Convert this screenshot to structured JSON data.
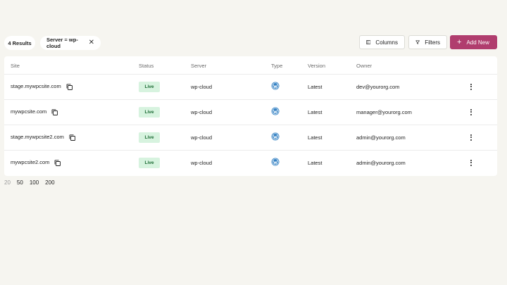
{
  "toolbar": {
    "results_label": "4 Results",
    "filter_chip": "Server = wp-cloud",
    "columns_label": "Columns",
    "filters_label": "Filters",
    "add_label": "Add New"
  },
  "table": {
    "columns": [
      "Site",
      "Status",
      "Server",
      "Type",
      "Version",
      "Owner"
    ],
    "rows": [
      {
        "site": "stage.mywpcsite.com",
        "status": "Live",
        "server": "wp-cloud",
        "version": "Latest",
        "owner": "dev@yourorg.com"
      },
      {
        "site": "mywpcsite.com",
        "status": "Live",
        "server": "wp-cloud",
        "version": "Latest",
        "owner": "manager@yourorg.com"
      },
      {
        "site": "stage.mywpcsite2.com",
        "status": "Live",
        "server": "wp-cloud",
        "version": "Latest",
        "owner": "admin@yourorg.com"
      },
      {
        "site": "mywpcsite2.com",
        "status": "Live",
        "server": "wp-cloud",
        "version": "Latest",
        "owner": "admin@yourorg.com"
      }
    ]
  },
  "pagination": {
    "options": [
      "20",
      "50",
      "100",
      "200"
    ],
    "selected": "20"
  },
  "colors": {
    "accent": "#b03d6e",
    "live_bg": "#d7f3df",
    "live_text": "#1c6b34",
    "wordpress_blue": "#3582c4"
  },
  "icons": {
    "copy": "copy-icon",
    "type": "wordpress-icon",
    "row_menu": "more-vertical-icon",
    "columns": "columns-icon",
    "filters": "filter-icon",
    "add": "plus-icon",
    "remove_filter": "close-icon"
  }
}
